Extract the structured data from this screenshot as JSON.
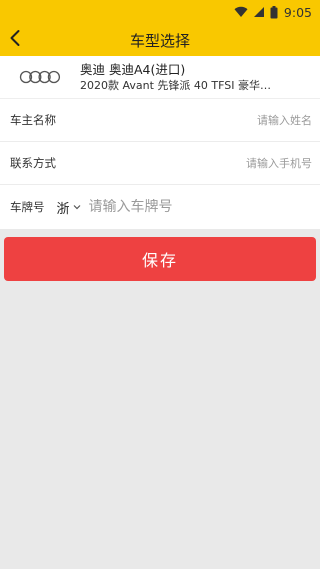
{
  "status_bar": {
    "time": "9:05",
    "icons": [
      "wifi-icon",
      "signal-icon",
      "battery-icon"
    ]
  },
  "header": {
    "title": "车型选择",
    "back_icon": "chevron-left-icon"
  },
  "car": {
    "logo_icon": "audi-logo",
    "name": "奥迪 奥迪A4(进口)",
    "description": "2020款 Avant 先锋派 40 TFSI 豪华…"
  },
  "form": {
    "owner_name": {
      "label": "车主名称",
      "placeholder": "请输入姓名",
      "value": ""
    },
    "contact": {
      "label": "联系方式",
      "placeholder": "请输入手机号",
      "value": ""
    },
    "plate": {
      "label": "车牌号",
      "province": "浙",
      "placeholder": "请输入车牌号",
      "value": ""
    }
  },
  "save_button": {
    "label": "保存"
  },
  "colors": {
    "header_bg": "#f9c800",
    "save_bg": "#ee4141",
    "page_bg": "#e9e9e9"
  }
}
